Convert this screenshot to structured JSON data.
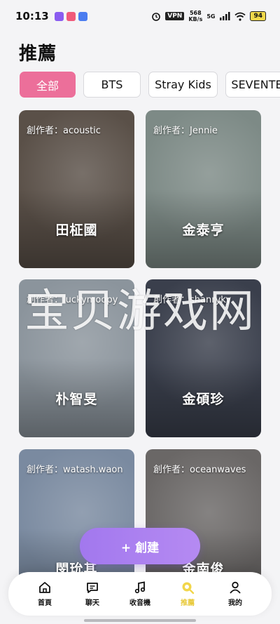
{
  "status_bar": {
    "time": "10:13",
    "vpn": "VPN",
    "speed_value": "568",
    "speed_unit": "KB/s",
    "network": "5G",
    "battery": "94"
  },
  "page": {
    "title": "推薦"
  },
  "chips": [
    "全部",
    "BTS",
    "Stray Kids",
    "SEVENTE"
  ],
  "cards": [
    {
      "creator": "創作者：acoustic",
      "name": "田柾國",
      "bg": "#5a5048"
    },
    {
      "creator": "創作者：Jennie",
      "name": "金泰亨",
      "bg": "#7d8a86"
    },
    {
      "creator": "創作者：luckymoopy",
      "name": "朴智旻",
      "bg": "#8b949c"
    },
    {
      "creator": "創作者：shanryky",
      "name": "金碩珍",
      "bg": "#3a3f4c"
    },
    {
      "creator": "創作者：watash.waon",
      "name": "閔玧其",
      "bg": "#7a8aa0"
    },
    {
      "creator": "創作者：oceanwaves",
      "name": "金南俊",
      "bg": "#6a6766"
    }
  ],
  "watermark": "宝贝游戏网",
  "create_button": {
    "label": "+ 創建"
  },
  "nav": [
    {
      "label": "首頁",
      "icon": "home-icon"
    },
    {
      "label": "聊天",
      "icon": "chat-icon"
    },
    {
      "label": "收音機",
      "icon": "music-note-icon"
    },
    {
      "label": "推薦",
      "icon": "recommend-icon",
      "active": true
    },
    {
      "label": "我的",
      "icon": "profile-icon"
    }
  ],
  "colors": {
    "accent_pink": "#ec6f9a",
    "create_purple": "#a278ee",
    "active_yellow": "#e8c93a"
  }
}
